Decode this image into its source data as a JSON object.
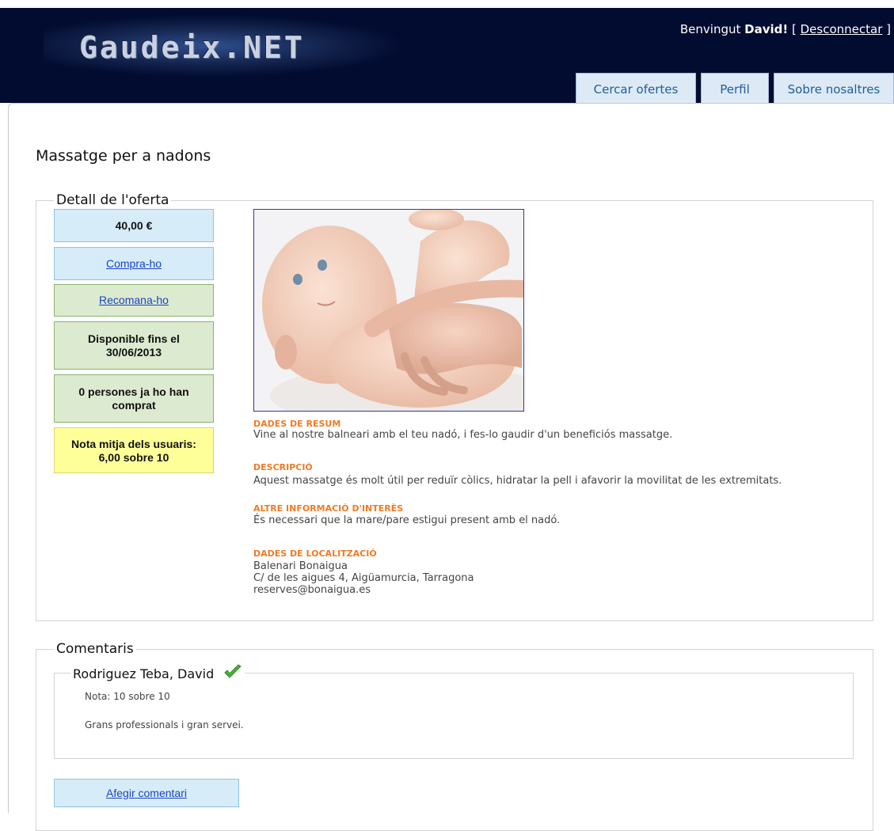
{
  "header": {
    "logo": "Gaudeix.NET",
    "welcome_prefix": "Benvingut ",
    "welcome_user": "David!",
    "bracket_open": " [ ",
    "logout": "Desconnectar",
    "bracket_close": " ]"
  },
  "nav": {
    "tabs": [
      {
        "label": "Cercar ofertes"
      },
      {
        "label": "Perfil"
      },
      {
        "label": "Sobre nosaltres"
      }
    ]
  },
  "page": {
    "title": "Massatge per a nadons"
  },
  "offer": {
    "legend": "Detall de l'oferta",
    "price": "40,00 €",
    "buy": "Compra-ho",
    "recommend": "Recomana-ho",
    "available_line1": "Disponible fins el",
    "available_line2": "30/06/2013",
    "bought_line1": "0 persones ja ho han",
    "bought_line2": "comprat",
    "rating_line1": "Nota mitja dels usuaris:",
    "rating_line2": "6,00 sobre 10",
    "summary_label": "DADES DE RESUM",
    "summary_text": "Vine al nostre balneari amb el teu nadó, i fes-lo gaudir d'un beneficiós massatge.",
    "description_label": "DESCRIPCIÓ",
    "description_text": "Aquest massatge és molt útil per reduïr còlics, hidratar la pell i afavorir la movilitat de les extremitats.",
    "other_label": "ALTRE INFORMACIÓ D'INTERÈS",
    "other_text": "És necessari que la mare/pare estigui present amb el nadó.",
    "location_label": "DADES DE LOCALITZACIÓ",
    "location_name": "Balenari Bonaigua",
    "location_address": "C/ de les aigues 4, Aigüamurcia, Tarragona",
    "location_email": "reserves@bonaigua.es"
  },
  "comments": {
    "legend": "Comentaris",
    "items": [
      {
        "author": "Rodriguez Teba, David",
        "rating": "Nota: 10 sobre 10",
        "text": "Grans professionals i gran servei.",
        "icon": "checkmark-icon"
      }
    ],
    "add_button": "Afegir comentari"
  },
  "colors": {
    "header_bg": "#020b30",
    "tab_bg": "#ddeaf6",
    "section_label": "#f07b24",
    "link": "#1a44c9",
    "blue_card": "#d6ecf8",
    "green_card": "#dcead0",
    "yellow_card": "#ffff99"
  }
}
